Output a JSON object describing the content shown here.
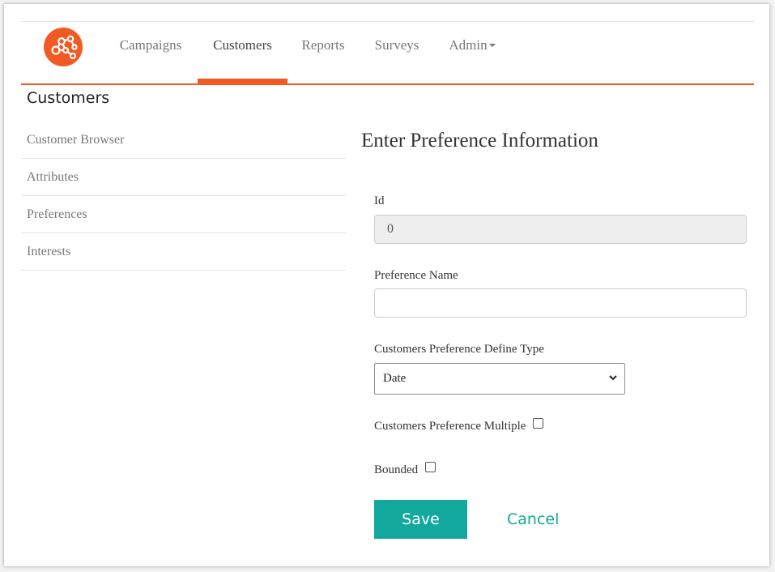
{
  "nav": {
    "items": [
      {
        "label": "Campaigns"
      },
      {
        "label": "Customers"
      },
      {
        "label": "Reports"
      },
      {
        "label": "Surveys"
      },
      {
        "label": "Admin"
      }
    ],
    "active": "Customers",
    "accent_color": "#f15a22",
    "logo_icon": "network-nodes-icon"
  },
  "section": {
    "title": "Customers"
  },
  "sidebar": {
    "items": [
      {
        "label": "Customer Browser"
      },
      {
        "label": "Attributes"
      },
      {
        "label": "Preferences"
      },
      {
        "label": "Interests"
      }
    ]
  },
  "form": {
    "title": "Enter Preference Information",
    "id_label": "Id",
    "id_value": "0",
    "name_label": "Preference Name",
    "name_value": "",
    "type_label": "Customers Preference Define Type",
    "type_value": "Date",
    "multiple_label": "Customers Preference Multiple",
    "multiple_checked": false,
    "bounded_label": "Bounded",
    "bounded_checked": false,
    "save_label": "Save",
    "cancel_label": "Cancel",
    "primary_color": "#12a89d"
  }
}
